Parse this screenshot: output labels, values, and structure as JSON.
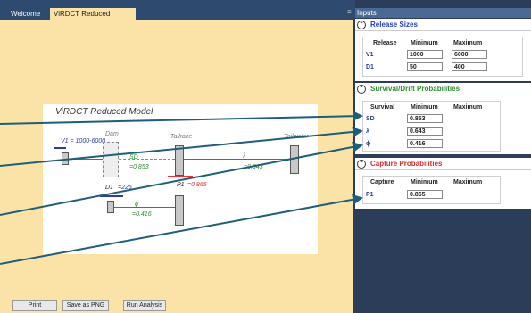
{
  "tabs": {
    "welcome": "Welcome",
    "model": "ViRDCT Reduced Model",
    "close": "×",
    "pin": "≡"
  },
  "diagram": {
    "title": "ViRDCT Reduced Model",
    "v1_label": "V1 = 1000-6000",
    "dam_label": "Dam",
    "tailrace_label": "Tailrace",
    "tailwater_label": "Tailwater",
    "sd_label": "SD",
    "sd_value": "=0.853",
    "lambda_label": "λ",
    "lambda_value": "=0.643",
    "d1_label": "D1",
    "d1_value": "=225",
    "p1_label": "P1",
    "p1_value": "=0.865",
    "phi_label": "ϕ",
    "phi_value": "=0.416"
  },
  "buttons": {
    "print": "Print",
    "save_png": "Save as PNG",
    "run": "Run Analysis"
  },
  "panel": {
    "title": "Inputs",
    "release": {
      "heading": "Release Sizes",
      "headers": [
        "Release",
        "Minimum",
        "Maximum"
      ],
      "rows": [
        {
          "name": "V1",
          "min": "1000",
          "max": "6000"
        },
        {
          "name": "D1",
          "min": "50",
          "max": "400"
        }
      ]
    },
    "survival": {
      "heading": "Survival/Drift Probabilities",
      "headers": [
        "Survival",
        "Minimum",
        "Maximum"
      ],
      "rows": [
        {
          "name": "SD",
          "min": "0.853"
        },
        {
          "name": "λ",
          "min": "0.643"
        },
        {
          "name": "ϕ",
          "min": "0.416"
        }
      ]
    },
    "capture": {
      "heading": "Capture Probabilities",
      "headers": [
        "Capture",
        "Minimum",
        "Maximum"
      ],
      "rows": [
        {
          "name": "P1",
          "min": "0.865"
        }
      ]
    }
  },
  "colors": {
    "canvas": "#fbe3a7",
    "release_heading": "#1f3fbf",
    "survival_heading": "#2f8a2f",
    "capture_heading": "#d32f2f",
    "annotation_arrow": "#1f5e7a"
  }
}
